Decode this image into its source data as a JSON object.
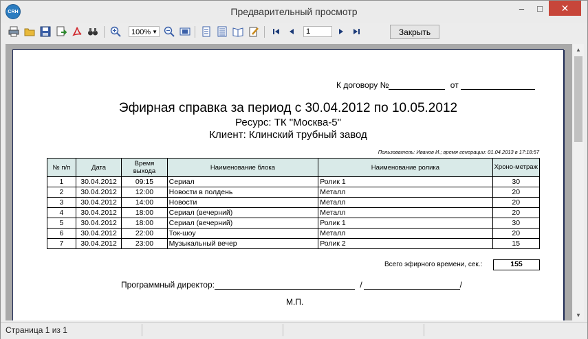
{
  "window": {
    "title": "Предварительный просмотр",
    "logo_text": "CRH",
    "controls": {
      "minimize": "–",
      "maximize": "□",
      "close": "✕"
    }
  },
  "toolbar": {
    "zoom_value": "100%",
    "page_value": "1",
    "close_label": "Закрыть"
  },
  "report": {
    "contract_label": "К договору №",
    "contract_from": "от",
    "title": "Эфирная справка за период с 30.04.2012 по 10.05.2012",
    "resource": "Ресурс: ТК \"Москва-5\"",
    "client": "Клиент: Клинский трубный завод",
    "user_info": "Пользователь: Иванов И.; время генерации: 01.04.2013 в 17:18:57",
    "columns": [
      "№ п/п",
      "Дата",
      "Время выхода",
      "Наименование блока",
      "Наименование ролика",
      "Хроно-метраж"
    ],
    "rows": [
      [
        "1",
        "30.04.2012",
        "09:15",
        "Сериал",
        "Ролик 1",
        "30"
      ],
      [
        "2",
        "30.04.2012",
        "12:00",
        "Новости в полдень",
        "Металл",
        "20"
      ],
      [
        "3",
        "30.04.2012",
        "14:00",
        "Новости",
        "Металл",
        "20"
      ],
      [
        "4",
        "30.04.2012",
        "18:00",
        "Сериал (вечерний)",
        "Металл",
        "20"
      ],
      [
        "5",
        "30.04.2012",
        "18:00",
        "Сериал (вечерний)",
        "Ролик 1",
        "30"
      ],
      [
        "6",
        "30.04.2012",
        "22:00",
        "Ток-шоу",
        "Металл",
        "20"
      ],
      [
        "7",
        "30.04.2012",
        "23:00",
        "Музыкальный вечер",
        "Ролик 2",
        "15"
      ]
    ],
    "total_label": "Всего эфирного времени, сек.:",
    "total_value": "155",
    "director_label": "Программный директор:",
    "slash": "/",
    "stamp": "М.П."
  },
  "status": {
    "page_text": "Страница 1 из 1"
  },
  "colors": {
    "header_fill": "#d9eae8",
    "close_button": "#c7463a",
    "page_border": "#1e2a55"
  }
}
